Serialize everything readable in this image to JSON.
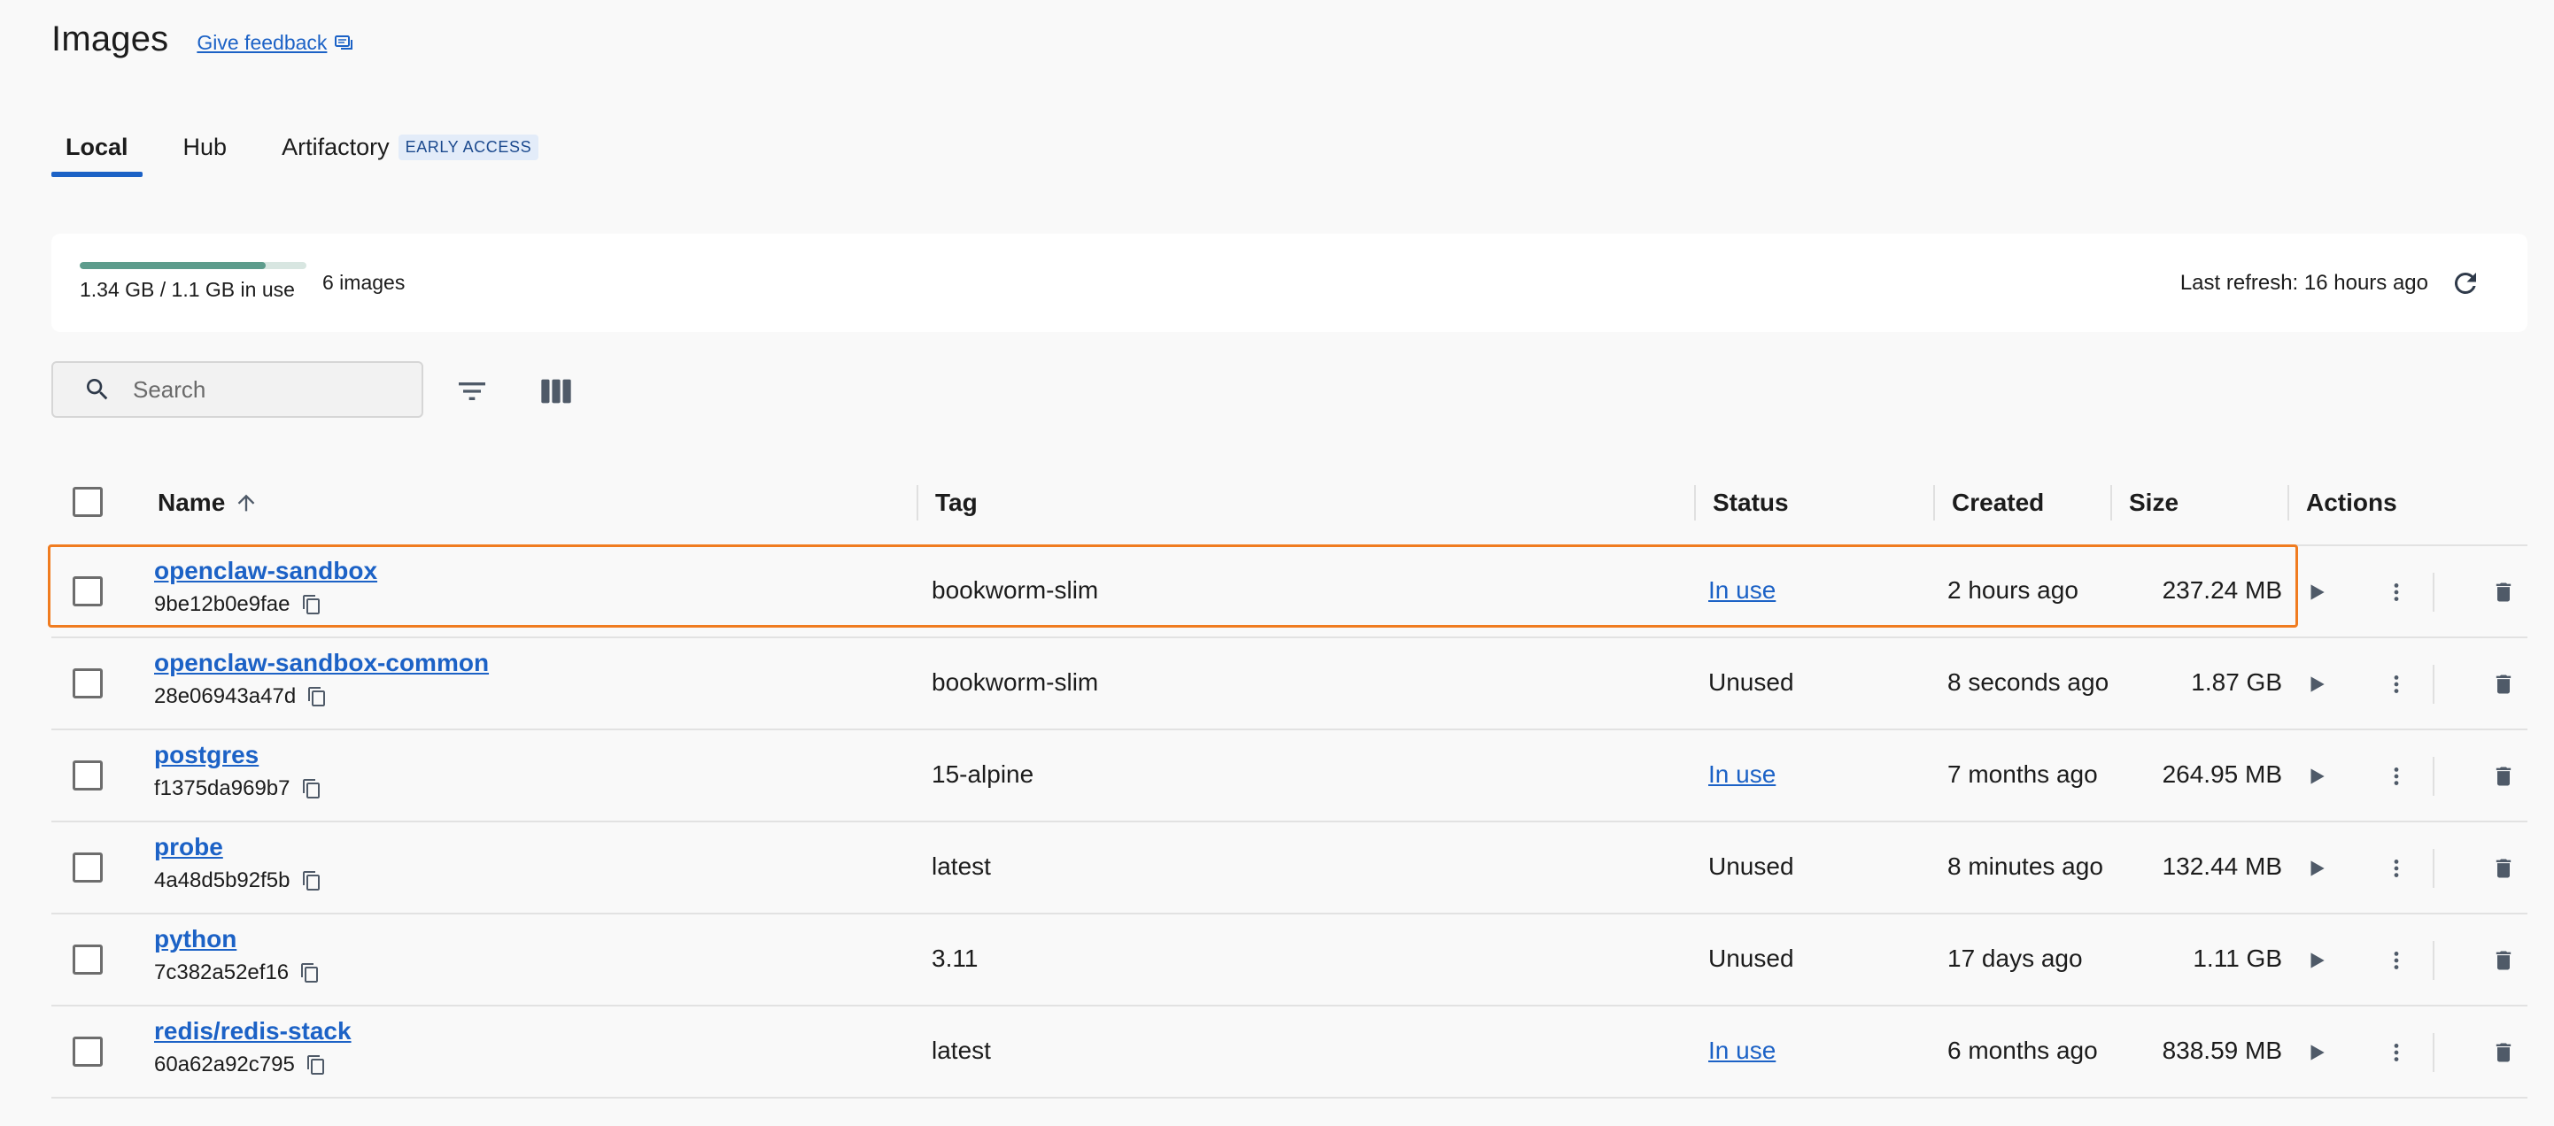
{
  "header": {
    "title": "Images",
    "feedback_label": "Give feedback"
  },
  "tabs": [
    {
      "label": "Local",
      "active": true
    },
    {
      "label": "Hub",
      "active": false
    },
    {
      "label": "Artifactory",
      "badge": "EARLY ACCESS",
      "active": false
    }
  ],
  "usage": {
    "used_fraction": 0.82,
    "text": "1.34 GB / 1.1 GB in use",
    "count": "6 images",
    "last_refresh": "Last refresh: 16 hours ago"
  },
  "search": {
    "placeholder": "Search",
    "value": ""
  },
  "table": {
    "columns": {
      "name": "Name",
      "tag": "Tag",
      "status": "Status",
      "created": "Created",
      "size": "Size",
      "actions": "Actions"
    },
    "sort": {
      "column": "Name",
      "direction": "ascending"
    },
    "rows": [
      {
        "name": "openclaw-sandbox",
        "id": "9be12b0e9fae",
        "tag": "bookworm-slim",
        "status": "In use",
        "in_use": true,
        "created": "2 hours ago",
        "size": "237.24 MB",
        "highlighted": true
      },
      {
        "name": "openclaw-sandbox-common",
        "id": "28e06943a47d",
        "tag": "bookworm-slim",
        "status": "Unused",
        "in_use": false,
        "created": "8 seconds ago",
        "size": "1.87 GB"
      },
      {
        "name": "postgres",
        "id": "f1375da969b7",
        "tag": "15-alpine",
        "status": "In use",
        "in_use": true,
        "created": "7 months ago",
        "size": "264.95 MB"
      },
      {
        "name": "probe",
        "id": "4a48d5b92f5b",
        "tag": "latest",
        "status": "Unused",
        "in_use": false,
        "created": "8 minutes ago",
        "size": "132.44 MB"
      },
      {
        "name": "python",
        "id": "7c382a52ef16",
        "tag": "3.11",
        "status": "Unused",
        "in_use": false,
        "created": "17 days ago",
        "size": "1.11 GB"
      },
      {
        "name": "redis/redis-stack",
        "id": "60a62a92c795",
        "tag": "latest",
        "status": "In use",
        "in_use": true,
        "created": "6 months ago",
        "size": "838.59 MB"
      }
    ]
  },
  "colors": {
    "accent": "#1c62c6",
    "usage_bar": "#5d9c8c",
    "highlight": "#f07c20",
    "icon": "#4f5a68"
  },
  "icons": {
    "feedback": "feedback-icon",
    "refresh": "refresh-icon",
    "search": "search-icon",
    "filter": "filter-icon",
    "columns": "columns-icon",
    "sort": "arrow-up-icon",
    "copy": "copy-icon",
    "run": "play-icon",
    "more": "more-vertical-icon",
    "delete": "trash-icon"
  }
}
